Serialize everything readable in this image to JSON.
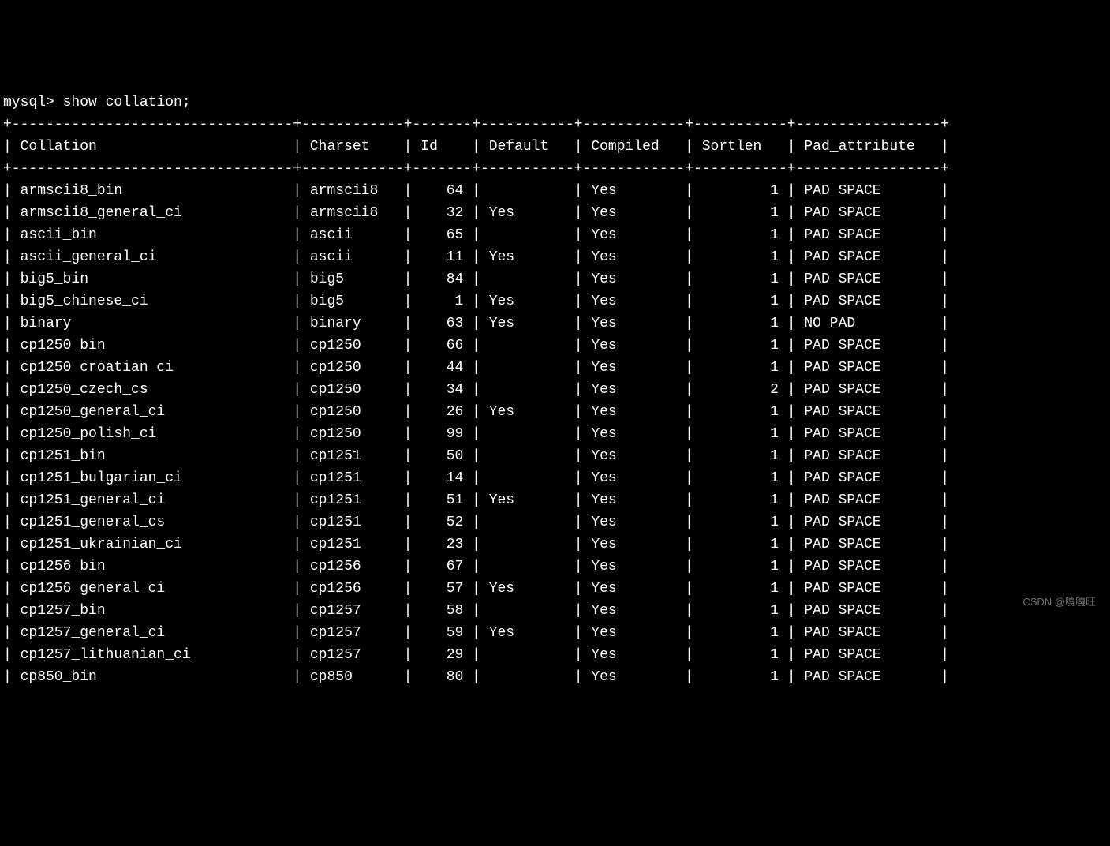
{
  "prompt": "mysql> ",
  "command": "show collation;",
  "columns": [
    "Collation",
    "Charset",
    "Id",
    "Default",
    "Compiled",
    "Sortlen",
    "Pad_attribute"
  ],
  "widths": {
    "collation": 31,
    "charset": 10,
    "id": 5,
    "default": 9,
    "compiled": 10,
    "sortlen": 9,
    "pad": 15
  },
  "rows": [
    {
      "collation": "armscii8_bin",
      "charset": "armscii8",
      "id": 64,
      "default": "",
      "compiled": "Yes",
      "sortlen": 1,
      "pad": "PAD SPACE"
    },
    {
      "collation": "armscii8_general_ci",
      "charset": "armscii8",
      "id": 32,
      "default": "Yes",
      "compiled": "Yes",
      "sortlen": 1,
      "pad": "PAD SPACE"
    },
    {
      "collation": "ascii_bin",
      "charset": "ascii",
      "id": 65,
      "default": "",
      "compiled": "Yes",
      "sortlen": 1,
      "pad": "PAD SPACE"
    },
    {
      "collation": "ascii_general_ci",
      "charset": "ascii",
      "id": 11,
      "default": "Yes",
      "compiled": "Yes",
      "sortlen": 1,
      "pad": "PAD SPACE"
    },
    {
      "collation": "big5_bin",
      "charset": "big5",
      "id": 84,
      "default": "",
      "compiled": "Yes",
      "sortlen": 1,
      "pad": "PAD SPACE"
    },
    {
      "collation": "big5_chinese_ci",
      "charset": "big5",
      "id": 1,
      "default": "Yes",
      "compiled": "Yes",
      "sortlen": 1,
      "pad": "PAD SPACE"
    },
    {
      "collation": "binary",
      "charset": "binary",
      "id": 63,
      "default": "Yes",
      "compiled": "Yes",
      "sortlen": 1,
      "pad": "NO PAD"
    },
    {
      "collation": "cp1250_bin",
      "charset": "cp1250",
      "id": 66,
      "default": "",
      "compiled": "Yes",
      "sortlen": 1,
      "pad": "PAD SPACE"
    },
    {
      "collation": "cp1250_croatian_ci",
      "charset": "cp1250",
      "id": 44,
      "default": "",
      "compiled": "Yes",
      "sortlen": 1,
      "pad": "PAD SPACE"
    },
    {
      "collation": "cp1250_czech_cs",
      "charset": "cp1250",
      "id": 34,
      "default": "",
      "compiled": "Yes",
      "sortlen": 2,
      "pad": "PAD SPACE"
    },
    {
      "collation": "cp1250_general_ci",
      "charset": "cp1250",
      "id": 26,
      "default": "Yes",
      "compiled": "Yes",
      "sortlen": 1,
      "pad": "PAD SPACE"
    },
    {
      "collation": "cp1250_polish_ci",
      "charset": "cp1250",
      "id": 99,
      "default": "",
      "compiled": "Yes",
      "sortlen": 1,
      "pad": "PAD SPACE"
    },
    {
      "collation": "cp1251_bin",
      "charset": "cp1251",
      "id": 50,
      "default": "",
      "compiled": "Yes",
      "sortlen": 1,
      "pad": "PAD SPACE"
    },
    {
      "collation": "cp1251_bulgarian_ci",
      "charset": "cp1251",
      "id": 14,
      "default": "",
      "compiled": "Yes",
      "sortlen": 1,
      "pad": "PAD SPACE"
    },
    {
      "collation": "cp1251_general_ci",
      "charset": "cp1251",
      "id": 51,
      "default": "Yes",
      "compiled": "Yes",
      "sortlen": 1,
      "pad": "PAD SPACE"
    },
    {
      "collation": "cp1251_general_cs",
      "charset": "cp1251",
      "id": 52,
      "default": "",
      "compiled": "Yes",
      "sortlen": 1,
      "pad": "PAD SPACE"
    },
    {
      "collation": "cp1251_ukrainian_ci",
      "charset": "cp1251",
      "id": 23,
      "default": "",
      "compiled": "Yes",
      "sortlen": 1,
      "pad": "PAD SPACE"
    },
    {
      "collation": "cp1256_bin",
      "charset": "cp1256",
      "id": 67,
      "default": "",
      "compiled": "Yes",
      "sortlen": 1,
      "pad": "PAD SPACE"
    },
    {
      "collation": "cp1256_general_ci",
      "charset": "cp1256",
      "id": 57,
      "default": "Yes",
      "compiled": "Yes",
      "sortlen": 1,
      "pad": "PAD SPACE"
    },
    {
      "collation": "cp1257_bin",
      "charset": "cp1257",
      "id": 58,
      "default": "",
      "compiled": "Yes",
      "sortlen": 1,
      "pad": "PAD SPACE"
    },
    {
      "collation": "cp1257_general_ci",
      "charset": "cp1257",
      "id": 59,
      "default": "Yes",
      "compiled": "Yes",
      "sortlen": 1,
      "pad": "PAD SPACE"
    },
    {
      "collation": "cp1257_lithuanian_ci",
      "charset": "cp1257",
      "id": 29,
      "default": "",
      "compiled": "Yes",
      "sortlen": 1,
      "pad": "PAD SPACE"
    },
    {
      "collation": "cp850_bin",
      "charset": "cp850",
      "id": 80,
      "default": "",
      "compiled": "Yes",
      "sortlen": 1,
      "pad": "PAD SPACE"
    }
  ],
  "watermark": "CSDN @嘎嘎旺"
}
